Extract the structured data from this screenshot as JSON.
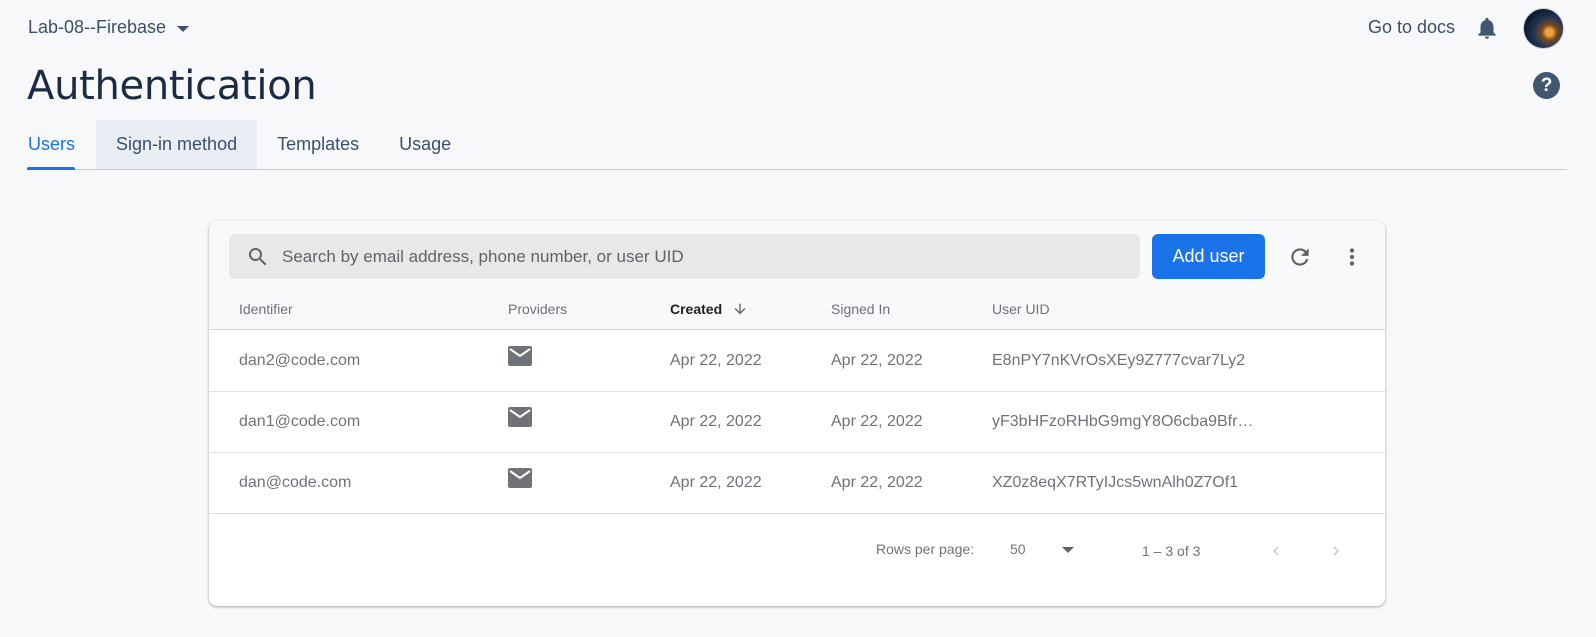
{
  "header": {
    "project_name": "Lab-08--Firebase",
    "docs_link": "Go to docs"
  },
  "page": {
    "title": "Authentication",
    "help": "?"
  },
  "tabs": [
    {
      "label": "Users",
      "active": true
    },
    {
      "label": "Sign-in method",
      "active": false
    },
    {
      "label": "Templates",
      "active": false
    },
    {
      "label": "Usage",
      "active": false
    }
  ],
  "search": {
    "placeholder": "Search by email address, phone number, or user UID"
  },
  "toolbar": {
    "add_user_label": "Add user"
  },
  "table": {
    "columns": [
      "Identifier",
      "Providers",
      "Created",
      "Signed In",
      "User UID"
    ],
    "sorted_column": "Created",
    "rows": [
      {
        "identifier": "dan2@code.com",
        "provider_icon": "email-icon",
        "created": "Apr 22, 2022",
        "signed_in": "Apr 22, 2022",
        "uid": "E8nPY7nKVrOsXEy9Z777cvar7Ly2"
      },
      {
        "identifier": "dan1@code.com",
        "provider_icon": "email-icon",
        "created": "Apr 22, 2022",
        "signed_in": "Apr 22, 2022",
        "uid": "yF3bHFzoRHbG9mgY8O6cba9Bfr…"
      },
      {
        "identifier": "dan@code.com",
        "provider_icon": "email-icon",
        "created": "Apr 22, 2022",
        "signed_in": "Apr 22, 2022",
        "uid": "XZ0z8eqX7RTyIJcs5wnAlh0Z7Of1"
      }
    ]
  },
  "pagination": {
    "rows_per_page_label": "Rows per page:",
    "rows_per_page_value": "50",
    "range": "1 – 3 of 3"
  },
  "colors": {
    "accent": "#1a73e8",
    "title": "#1b2b45",
    "nav_text": "#3c4f6a"
  }
}
